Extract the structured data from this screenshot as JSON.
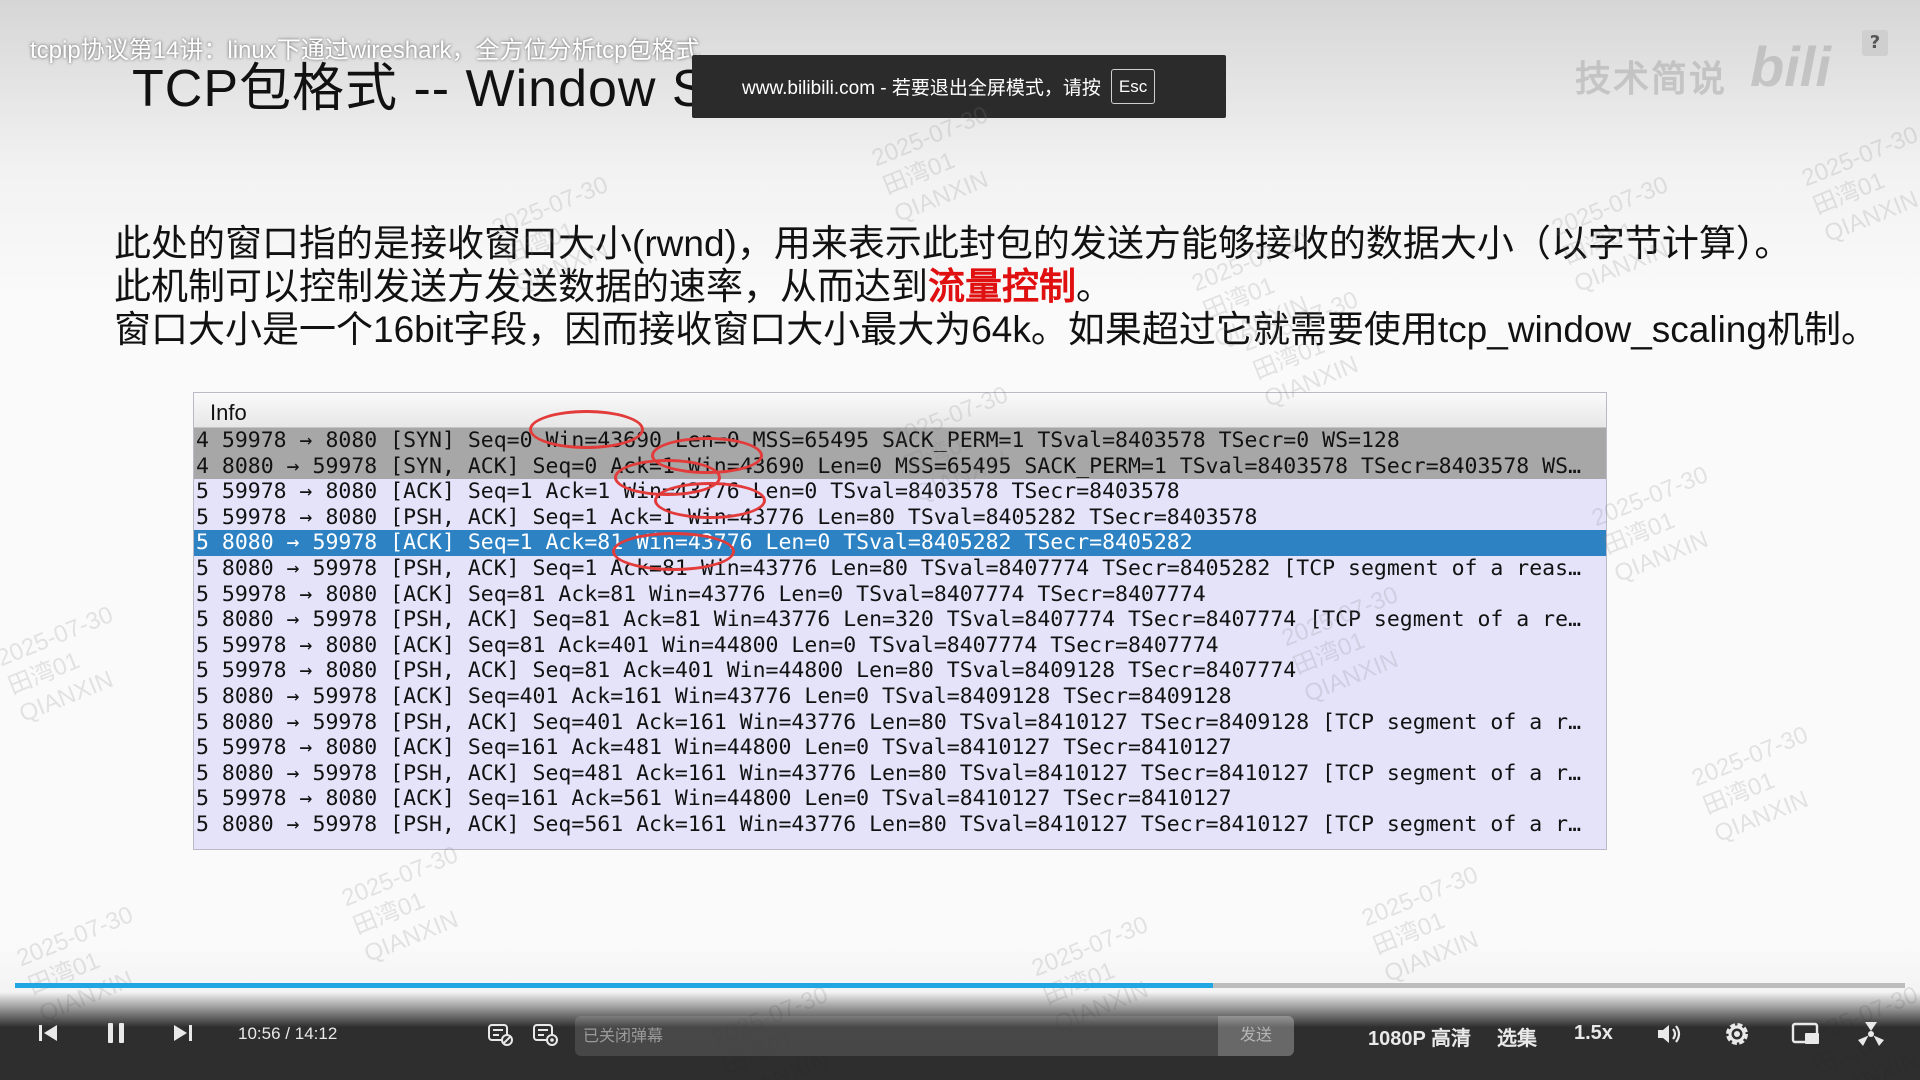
{
  "video": {
    "title": "tcpip协议第14讲：linux下通过wireshark，全方位分析tcp包格式",
    "fullscreen_notice": "www.bilibili.com - 若要退出全屏模式，请按",
    "esc_key": "Esc",
    "help_icon": "question-icon",
    "logo_text_1": "技术简说",
    "logo_text_2": "bili"
  },
  "slide": {
    "title": "TCP包格式 -- Window Size",
    "desc_line1": "此处的窗口指的是接收窗口大小(rwnd)，用来表示此封包的发送方能够接收的数据大小（以字节计算）。",
    "desc_line2_prefix": "此机制可以控制发送方发送数据的速率，从而达到",
    "desc_line2_highlight": "流量控制",
    "desc_line2_suffix": "。",
    "desc_line3": "窗口大小是一个16bit字段，因而接收窗口大小最大为64k。如果超过它就需要使用tcp_window_scaling机制。",
    "highlight_color": "#e01010"
  },
  "packets": {
    "column_header": "Info",
    "rows": [
      {
        "text": "4 59978 → 8080 [SYN] Seq=0 Win=43690 Len=0 MSS=65495 SACK_PERM=1 TSval=8403578 TSecr=0 WS=128",
        "style": "gray"
      },
      {
        "text": "4 8080 → 59978 [SYN, ACK] Seq=0 Ack=1 Win=43690 Len=0 MSS=65495 SACK_PERM=1 TSval=8403578 TSecr=8403578 WS…",
        "style": "gray"
      },
      {
        "text": "5 59978 → 8080 [ACK] Seq=1 Ack=1 Win=43776 Len=0 TSval=8403578 TSecr=8403578",
        "style": "normal"
      },
      {
        "text": "5 59978 → 8080 [PSH, ACK] Seq=1 Ack=1 Win=43776 Len=80 TSval=8405282 TSecr=8403578",
        "style": "normal"
      },
      {
        "text": "5 8080 → 59978 [ACK] Seq=1 Ack=81 Win=43776 Len=0 TSval=8405282 TSecr=8405282",
        "style": "selected"
      },
      {
        "text": "5 8080 → 59978 [PSH, ACK] Seq=1 Ack=81 Win=43776 Len=80 TSval=8407774 TSecr=8405282 [TCP segment of a reas…",
        "style": "normal"
      },
      {
        "text": "5 59978 → 8080 [ACK] Seq=81 Ack=81 Win=43776 Len=0 TSval=8407774 TSecr=8407774",
        "style": "normal"
      },
      {
        "text": "5 8080 → 59978 [PSH, ACK] Seq=81 Ack=81 Win=43776 Len=320 TSval=8407774 TSecr=8407774 [TCP segment of a re…",
        "style": "normal"
      },
      {
        "text": "5 59978 → 8080 [ACK] Seq=81 Ack=401 Win=44800 Len=0 TSval=8407774 TSecr=8407774",
        "style": "normal"
      },
      {
        "text": "5 59978 → 8080 [PSH, ACK] Seq=81 Ack=401 Win=44800 Len=80 TSval=8409128 TSecr=8407774",
        "style": "normal"
      },
      {
        "text": "5 8080 → 59978 [ACK] Seq=401 Ack=161 Win=43776 Len=0 TSval=8409128 TSecr=8409128",
        "style": "normal"
      },
      {
        "text": "5 8080 → 59978 [PSH, ACK] Seq=401 Ack=161 Win=43776 Len=80 TSval=8410127 TSecr=8409128 [TCP segment of a r…",
        "style": "normal"
      },
      {
        "text": "5 59978 → 8080 [ACK] Seq=161 Ack=481 Win=44800 Len=0 TSval=8410127 TSecr=8410127",
        "style": "normal"
      },
      {
        "text": "5 8080 → 59978 [PSH, ACK] Seq=481 Ack=161 Win=43776 Len=80 TSval=8410127 TSecr=8410127 [TCP segment of a r…",
        "style": "normal"
      },
      {
        "text": "5 59978 → 8080 [ACK] Seq=161 Ack=561 Win=44800 Len=0 TSval=8410127 TSecr=8410127",
        "style": "normal"
      },
      {
        "text": "5 8080 → 59978 [PSH, ACK] Seq=561 Ack=161 Win=43776 Len=80 TSval=8410127 TSecr=8410127 [TCP segment of a r…",
        "style": "normal"
      }
    ],
    "row_gray_color": "#a7a7a7",
    "row_bg_color": "#e4e3fa",
    "row_selected_color": "#2d82c4",
    "annotation_color": "#e33a3a"
  },
  "watermark": {
    "date": "2025-07-30",
    "user": "田湾01",
    "org": "QIANXIN"
  },
  "player": {
    "progress_fraction": 0.634,
    "progress_color": "#20a6e0",
    "current_time": "10:56",
    "time_separator": "/",
    "duration": "14:12",
    "danmaku_placeholder": "已关闭弹幕",
    "send_label": "发送",
    "quality_label": "1080P 高清",
    "episodes_label": "选集",
    "speed_label": "1.5x",
    "icons": {
      "prev": "skip-previous-icon",
      "pause": "pause-icon",
      "next": "skip-next-icon",
      "danmaku_toggle": "danmaku-toggle-icon",
      "danmaku_settings": "danmaku-settings-icon",
      "volume": "volume-icon",
      "settings": "gear-icon",
      "pip": "picture-in-picture-icon",
      "fullscreen": "fullscreen-exit-icon"
    }
  }
}
